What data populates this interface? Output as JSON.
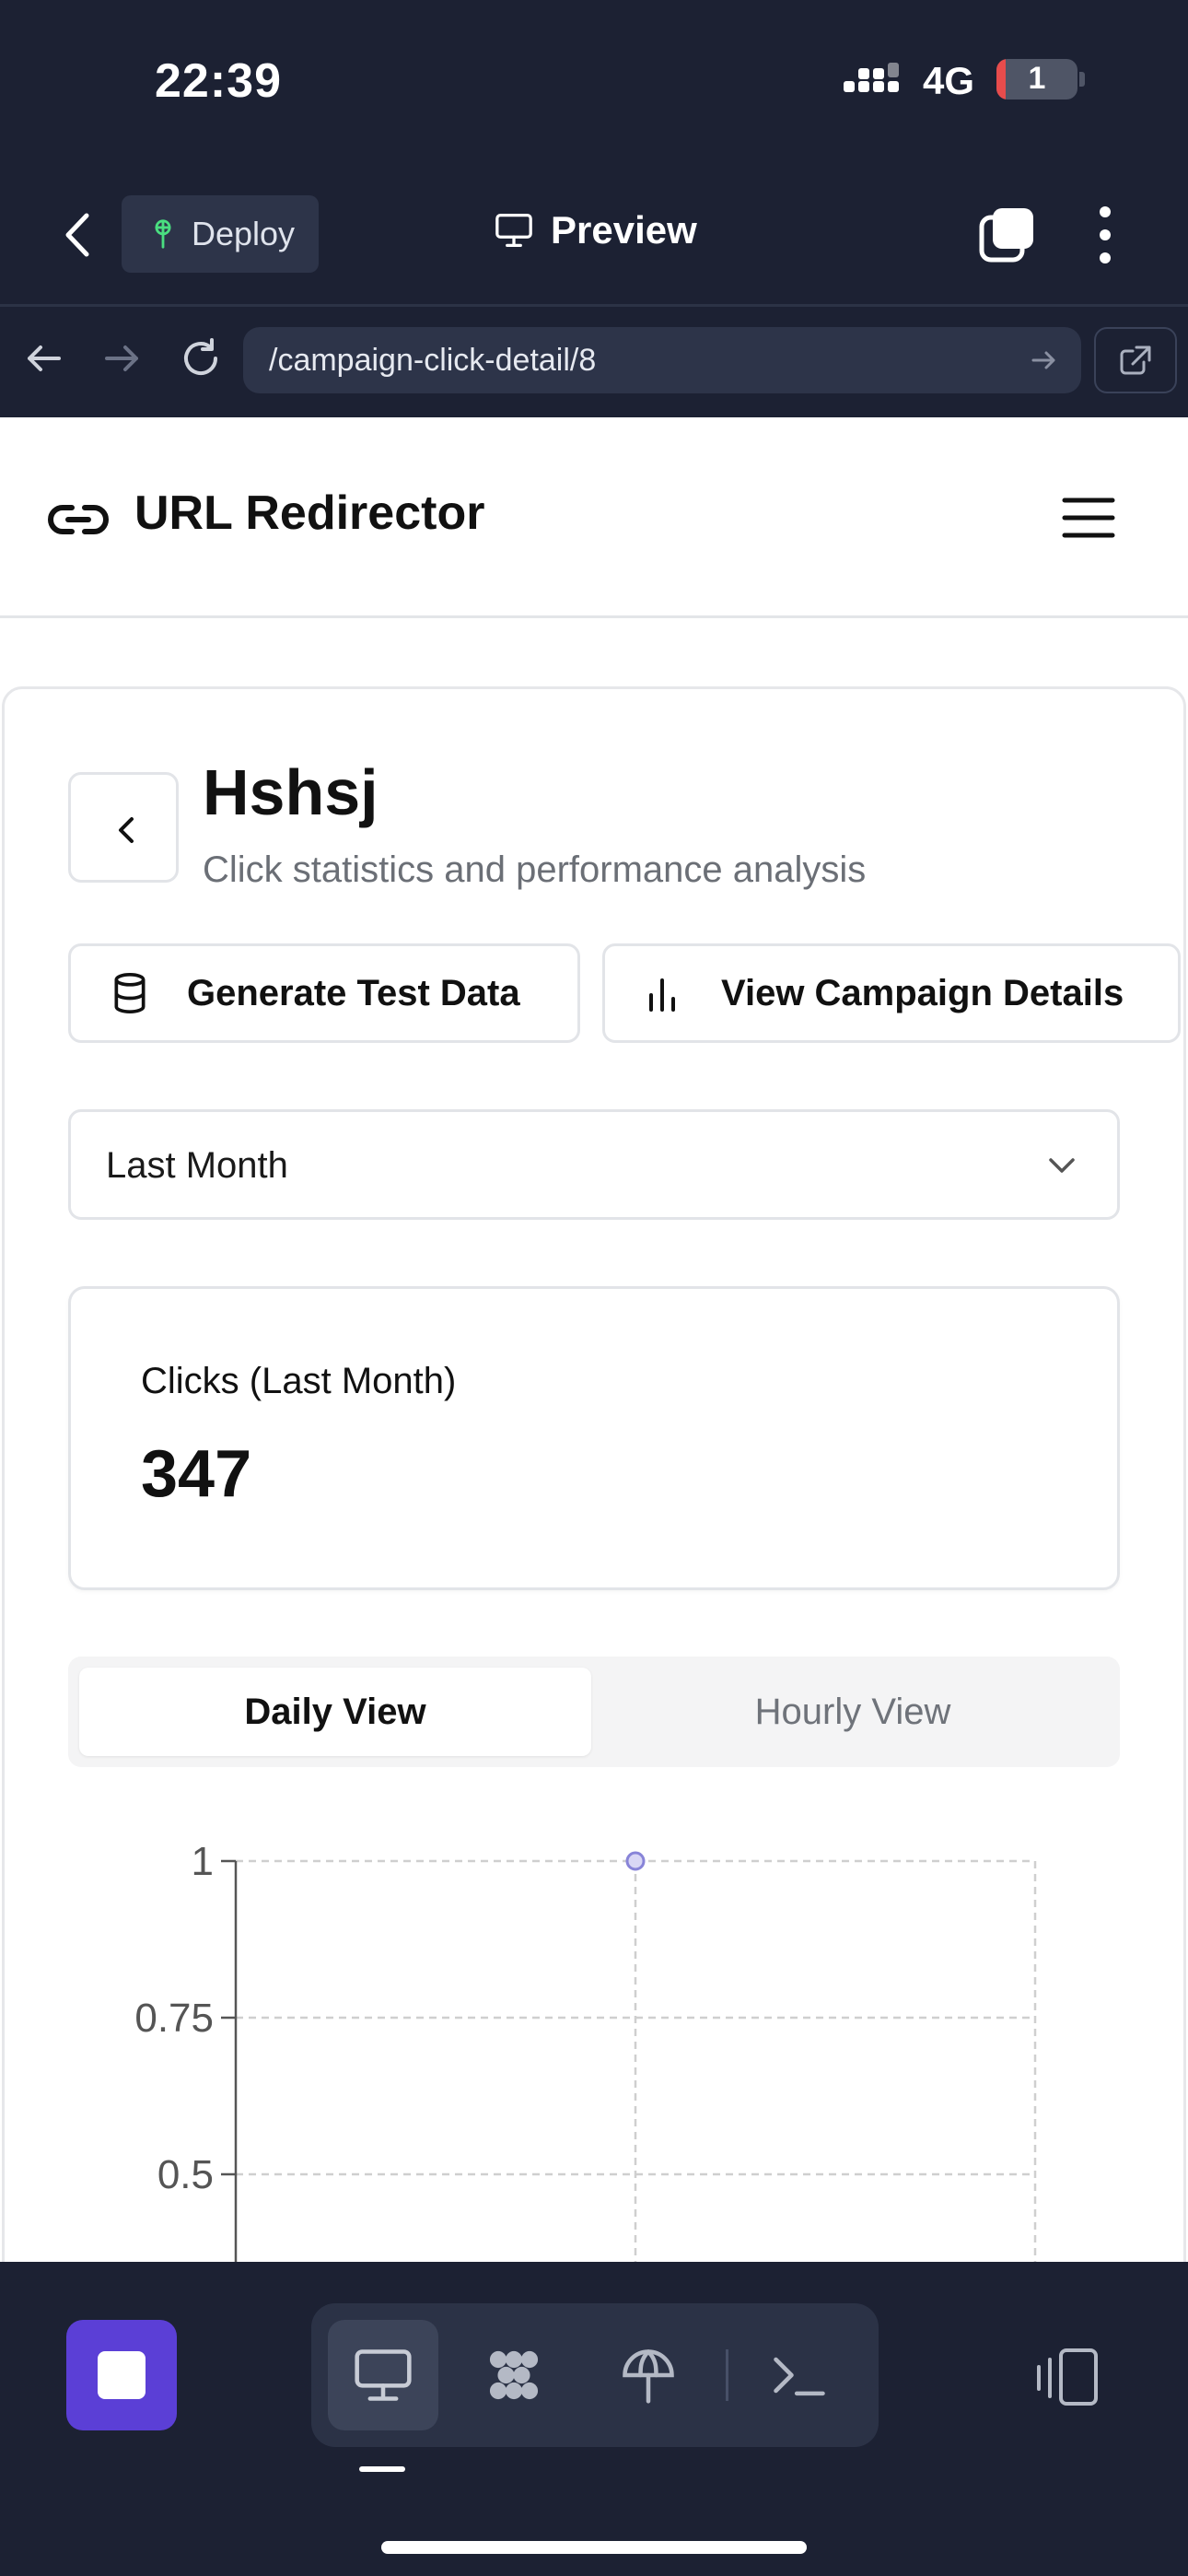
{
  "status_bar": {
    "time": "22:39",
    "network": "4G",
    "battery": "1"
  },
  "toolbar": {
    "deploy_label": "Deploy",
    "preview_label": "Preview"
  },
  "browser": {
    "url": "/campaign-click-detail/8"
  },
  "site": {
    "title": "URL Redirector"
  },
  "campaign": {
    "title": "Hshsj",
    "subtitle": "Click statistics and performance analysis",
    "generate_label": "Generate Test Data",
    "details_label": "View Campaign Details",
    "period_selected": "Last Month",
    "stat_label": "Clicks (Last Month)",
    "stat_value": "347",
    "view_tabs": [
      "Daily View",
      "Hourly View"
    ],
    "active_view": "Daily View"
  },
  "colors": {
    "accent": "#5b3fd6",
    "dark_bg": "#1c2133",
    "point": "#8884d8"
  },
  "chart_data": {
    "type": "line",
    "title": "",
    "xlabel": "",
    "ylabel": "",
    "y_ticks": [
      "1",
      "0.75",
      "0.5"
    ],
    "ylim": [
      0,
      1
    ],
    "grid": true,
    "series": [
      {
        "values": [
          1
        ]
      }
    ]
  },
  "icons": {
    "toolbar": [
      "chevron-left-icon",
      "sprout-icon",
      "monitor-icon",
      "tabs-icon",
      "more-vertical-icon"
    ],
    "browser": [
      "arrow-left-icon",
      "arrow-right-icon",
      "reload-icon",
      "external-link-icon"
    ],
    "bottom": [
      "stop-icon",
      "monitor-icon",
      "packages-icon",
      "deploy-icon",
      "terminal-icon",
      "device-toggle-icon"
    ]
  }
}
